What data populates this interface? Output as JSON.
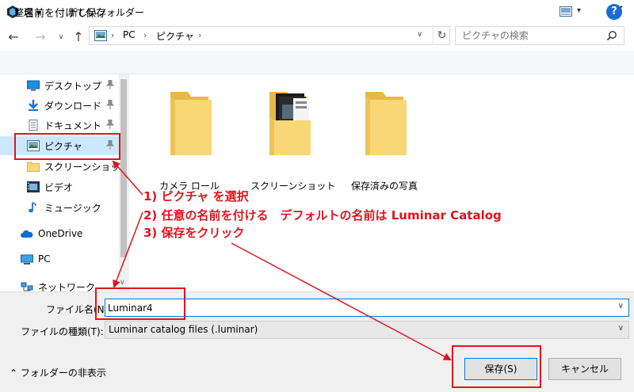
{
  "window": {
    "title": "名前を付けて保存",
    "close_glyph": "✕"
  },
  "addressbar": {
    "segments": [
      "PC",
      "ピクチャ"
    ],
    "separator": "›"
  },
  "search": {
    "placeholder": "ピクチャの検索"
  },
  "toolbar": {
    "organize_label": "整理 ▾",
    "new_folder_label": "新しいフォルダー",
    "help_label": "?"
  },
  "nav": {
    "items": [
      {
        "label": "デスクトップ",
        "icon": "desktop-icon",
        "pinned": true
      },
      {
        "label": "ダウンロード",
        "icon": "download-icon",
        "pinned": true
      },
      {
        "label": "ドキュメント",
        "icon": "documents-icon",
        "pinned": true
      },
      {
        "label": "ピクチャ",
        "icon": "pictures-icon",
        "pinned": true,
        "selected": true
      },
      {
        "label": "スクリーンショット",
        "icon": "folder-icon",
        "pinned": false
      },
      {
        "label": "ビデオ",
        "icon": "video-icon",
        "pinned": false
      },
      {
        "label": "ミュージック",
        "icon": "music-icon",
        "pinned": false
      },
      {
        "label": "OneDrive",
        "icon": "cloud-icon",
        "pinned": false
      },
      {
        "label": "PC",
        "icon": "pc-icon",
        "pinned": false
      },
      {
        "label": "ネットワーク",
        "icon": "network-icon",
        "pinned": false
      }
    ]
  },
  "folders": [
    {
      "label": "カメラ ロール"
    },
    {
      "label": "スクリーンショット"
    },
    {
      "label": "保存済みの写真"
    }
  ],
  "form": {
    "filename_label": "ファイル名(N):",
    "filename_value": "Luminar4",
    "filetype_label": "ファイルの種類(T):",
    "filetype_value": "Luminar catalog files (.luminar)"
  },
  "footer": {
    "hide_folders_label": "⌃ フォルダーの非表示",
    "save_label": "保存(S)",
    "cancel_label": "キャンセル"
  },
  "annotations": {
    "step1": "1) ピクチャ を選択",
    "step2": "2) 任意の名前を付ける　デフォルトの名前は Luminar Catalog",
    "step3": "3) 保存をクリック",
    "color": "#e0141c"
  },
  "colors": {
    "accent": "#0078d7",
    "selection": "#cce8ff",
    "folder": "#f8d775"
  }
}
